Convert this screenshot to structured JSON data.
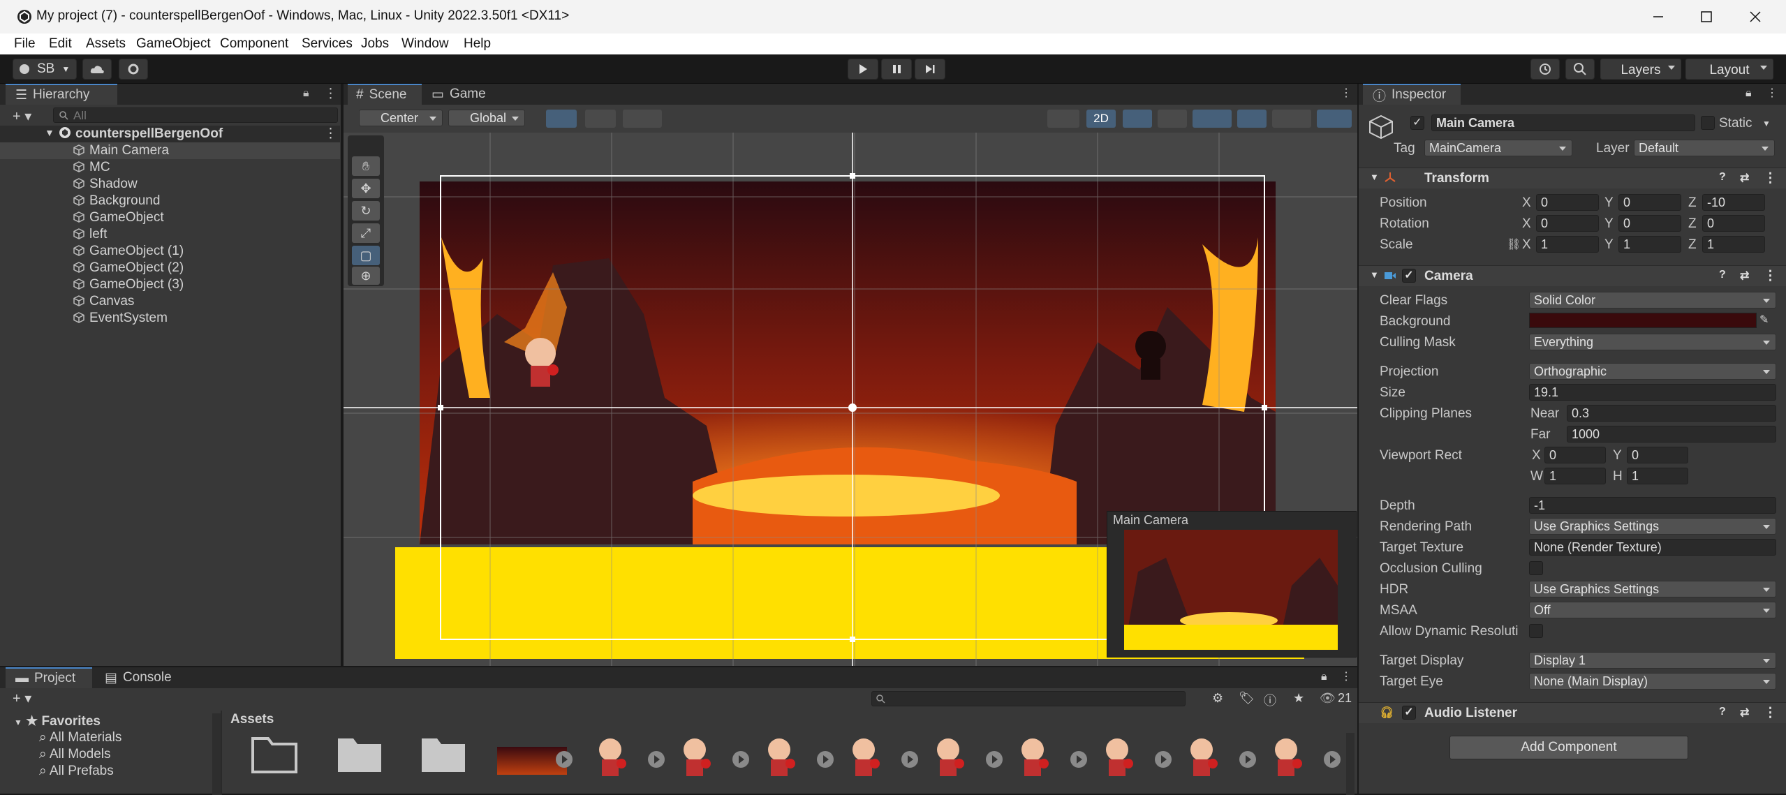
{
  "window": {
    "title": "My project (7) - counterspellBergenOof - Windows, Mac, Linux - Unity 2022.3.50f1 <DX11>"
  },
  "menu": [
    "File",
    "Edit",
    "Assets",
    "GameObject",
    "Component",
    "Services",
    "Jobs",
    "Window",
    "Help"
  ],
  "toolbar": {
    "account": "SB",
    "layers": "Layers",
    "layout": "Layout"
  },
  "hierarchy": {
    "tab": "Hierarchy",
    "search_placeholder": "All",
    "scene": "counterspellBergenOof",
    "items": [
      "Main Camera",
      "MC",
      "Shadow",
      "Background",
      "GameObject",
      "left",
      "GameObject (1)",
      "GameObject (2)",
      "GameObject (3)",
      "Canvas",
      "EventSystem"
    ]
  },
  "scene_view": {
    "tabs": [
      "Scene",
      "Game"
    ],
    "pivot": "Center",
    "space": "Global",
    "mode_2d": "2D",
    "camera_preview_title": "Main Camera"
  },
  "inspector": {
    "tab": "Inspector",
    "object_name": "Main Camera",
    "static_label": "Static",
    "tag_label": "Tag",
    "tag_value": "MainCamera",
    "layer_label": "Layer",
    "layer_value": "Default",
    "transform": {
      "title": "Transform",
      "position_label": "Position",
      "rotation_label": "Rotation",
      "scale_label": "Scale",
      "position": [
        "0",
        "0",
        "-10"
      ],
      "rotation": [
        "0",
        "0",
        "0"
      ],
      "scale": [
        "1",
        "1",
        "1"
      ],
      "axes": [
        "X",
        "Y",
        "Z"
      ]
    },
    "camera": {
      "title": "Camera",
      "clear_flags_label": "Clear Flags",
      "clear_flags": "Solid Color",
      "background_label": "Background",
      "background_color": "#3a0a0c",
      "culling_mask_label": "Culling Mask",
      "culling_mask": "Everything",
      "projection_label": "Projection",
      "projection": "Orthographic",
      "size_label": "Size",
      "size": "19.1",
      "clipping_label": "Clipping Planes",
      "near_label": "Near",
      "near": "0.3",
      "far_label": "Far",
      "far": "1000",
      "viewport_label": "Viewport Rect",
      "vp_x_label": "X",
      "vp_x": "0",
      "vp_y_label": "Y",
      "vp_y": "0",
      "vp_w_label": "W",
      "vp_w": "1",
      "vp_h_label": "H",
      "vp_h": "1",
      "depth_label": "Depth",
      "depth": "-1",
      "rendering_path_label": "Rendering Path",
      "rendering_path": "Use Graphics Settings",
      "target_texture_label": "Target Texture",
      "target_texture": "None (Render Texture)",
      "occlusion_label": "Occlusion Culling",
      "hdr_label": "HDR",
      "hdr": "Use Graphics Settings",
      "msaa_label": "MSAA",
      "msaa": "Off",
      "dynamic_res_label": "Allow Dynamic Resoluti",
      "target_display_label": "Target Display",
      "target_display": "Display 1",
      "target_eye_label": "Target Eye",
      "target_eye": "None (Main Display)"
    },
    "audio_listener": {
      "title": "Audio Listener"
    },
    "add_component": "Add Component"
  },
  "project": {
    "tabs": [
      "Project",
      "Console"
    ],
    "favorites_label": "Favorites",
    "favorites": [
      "All Materials",
      "All Models",
      "All Prefabs"
    ],
    "breadcrumb": "Assets",
    "count": "21"
  },
  "colors": {
    "accent": "#4a86c8",
    "lava_yellow": "#ffe000",
    "bg_panel": "#383838"
  }
}
